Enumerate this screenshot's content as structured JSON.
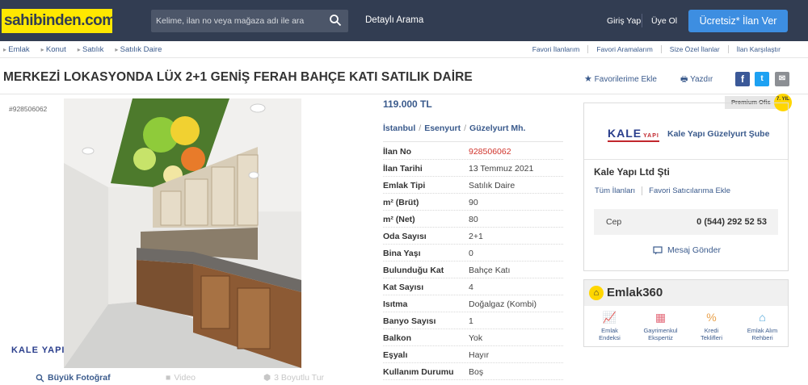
{
  "header": {
    "logo": "sahibinden.com",
    "search_placeholder": "Kelime, ilan no veya mağaza adı ile ara",
    "advanced_search": "Detaylı Arama",
    "login": "Giriş Yap",
    "signup": "Üye Ol",
    "post_button": "Ücretsiz* İlan Ver"
  },
  "breadcrumb": [
    "Emlak",
    "Konut",
    "Satılık",
    "Satılık Daire"
  ],
  "top_links": [
    "Favori İlanlarım",
    "Favori Aramalarım",
    "Size Özel İlanlar",
    "İlan Karşılaştır"
  ],
  "listing": {
    "title": "MERKEZİ LOKASYONDA LÜX 2+1 GENİŞ FERAH BAHÇE KATI SATILIK DAİRE",
    "favorite": "Favorilerime Ekle",
    "print": "Yazdır",
    "id_label": "#928506062",
    "price": "119.000 TL",
    "location": [
      "İstanbul",
      "Esenyurt",
      "Güzelyurt Mh."
    ],
    "photo_controls": {
      "large": "Büyük Fotoğraf",
      "video": "Video",
      "tour": "3 Boyutlu Tur"
    },
    "watermark": "KALE YAPI"
  },
  "attributes": [
    {
      "k": "İlan No",
      "v": "928506062"
    },
    {
      "k": "İlan Tarihi",
      "v": "13 Temmuz 2021"
    },
    {
      "k": "Emlak Tipi",
      "v": "Satılık Daire"
    },
    {
      "k": "m² (Brüt)",
      "v": "90"
    },
    {
      "k": "m² (Net)",
      "v": "80"
    },
    {
      "k": "Oda Sayısı",
      "v": "2+1"
    },
    {
      "k": "Bina Yaşı",
      "v": "0"
    },
    {
      "k": "Bulunduğu Kat",
      "v": "Bahçe Katı"
    },
    {
      "k": "Kat Sayısı",
      "v": "4"
    },
    {
      "k": "Isıtma",
      "v": "Doğalgaz (Kombi)"
    },
    {
      "k": "Banyo Sayısı",
      "v": "1"
    },
    {
      "k": "Balkon",
      "v": "Yok"
    },
    {
      "k": "Eşyalı",
      "v": "Hayır"
    },
    {
      "k": "Kullanım Durumu",
      "v": "Boş"
    }
  ],
  "seller": {
    "premium": "Premium Ofis",
    "badge": "7. YIL",
    "logo": "KALE",
    "logo_sub": "YAPI",
    "branch": "Kale Yapı Güzelyurt Şube",
    "name": "Kale Yapı Ltd Şti",
    "links": [
      "Tüm İlanları",
      "Favori Satıcılarıma Ekle"
    ],
    "phone_label": "Cep",
    "phone": "0 (544) 292 52 53",
    "message": "Mesaj Gönder"
  },
  "emlak360": {
    "title": "Emlak360",
    "items": [
      {
        "label1": "Emlak",
        "label2": "Endeksi",
        "icon": "chart-icon"
      },
      {
        "label1": "Gayrimenkul",
        "label2": "Ekspertiz",
        "icon": "building-icon"
      },
      {
        "label1": "Kredi",
        "label2": "Teklifleri",
        "icon": "percent-icon"
      },
      {
        "label1": "Emlak Alım",
        "label2": "Rehberi",
        "icon": "house-info-icon"
      }
    ]
  }
}
